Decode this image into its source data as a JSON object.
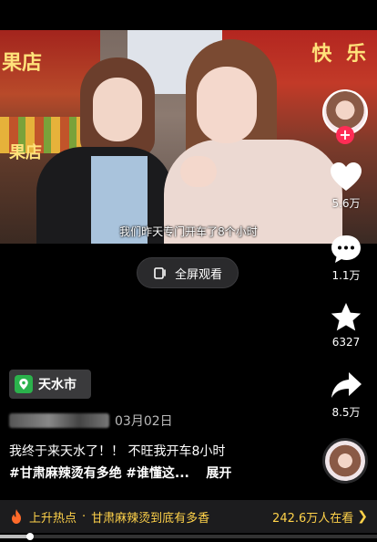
{
  "video": {
    "subtitle": "我们昨天专门开车了8个小时",
    "sign_left": "果店",
    "sign_left_lower": "果店",
    "sign_right": "快 乐"
  },
  "fullscreen": {
    "label": "全屏观看"
  },
  "actions": {
    "likes": "5.6万",
    "comments": "1.1万",
    "favorites": "6327",
    "shares": "8.5万"
  },
  "location": {
    "label": "天水市"
  },
  "post": {
    "date": "03月02日",
    "caption_line1": "我终于来天水了！！ 不旺我开车8小时",
    "hashtag1": "#甘肃麻辣烫有多绝",
    "hashtag2": "#谁懂这...",
    "expand": "展开"
  },
  "hot": {
    "rising": "上升热点",
    "dot": "·",
    "topic": "甘肃麻辣烫到底有多香",
    "viewers": "242.6万人在看"
  },
  "playback": {
    "progress": 0.08
  },
  "colors": {
    "accent": "#fe2c55",
    "hot": "#ffd24a"
  }
}
